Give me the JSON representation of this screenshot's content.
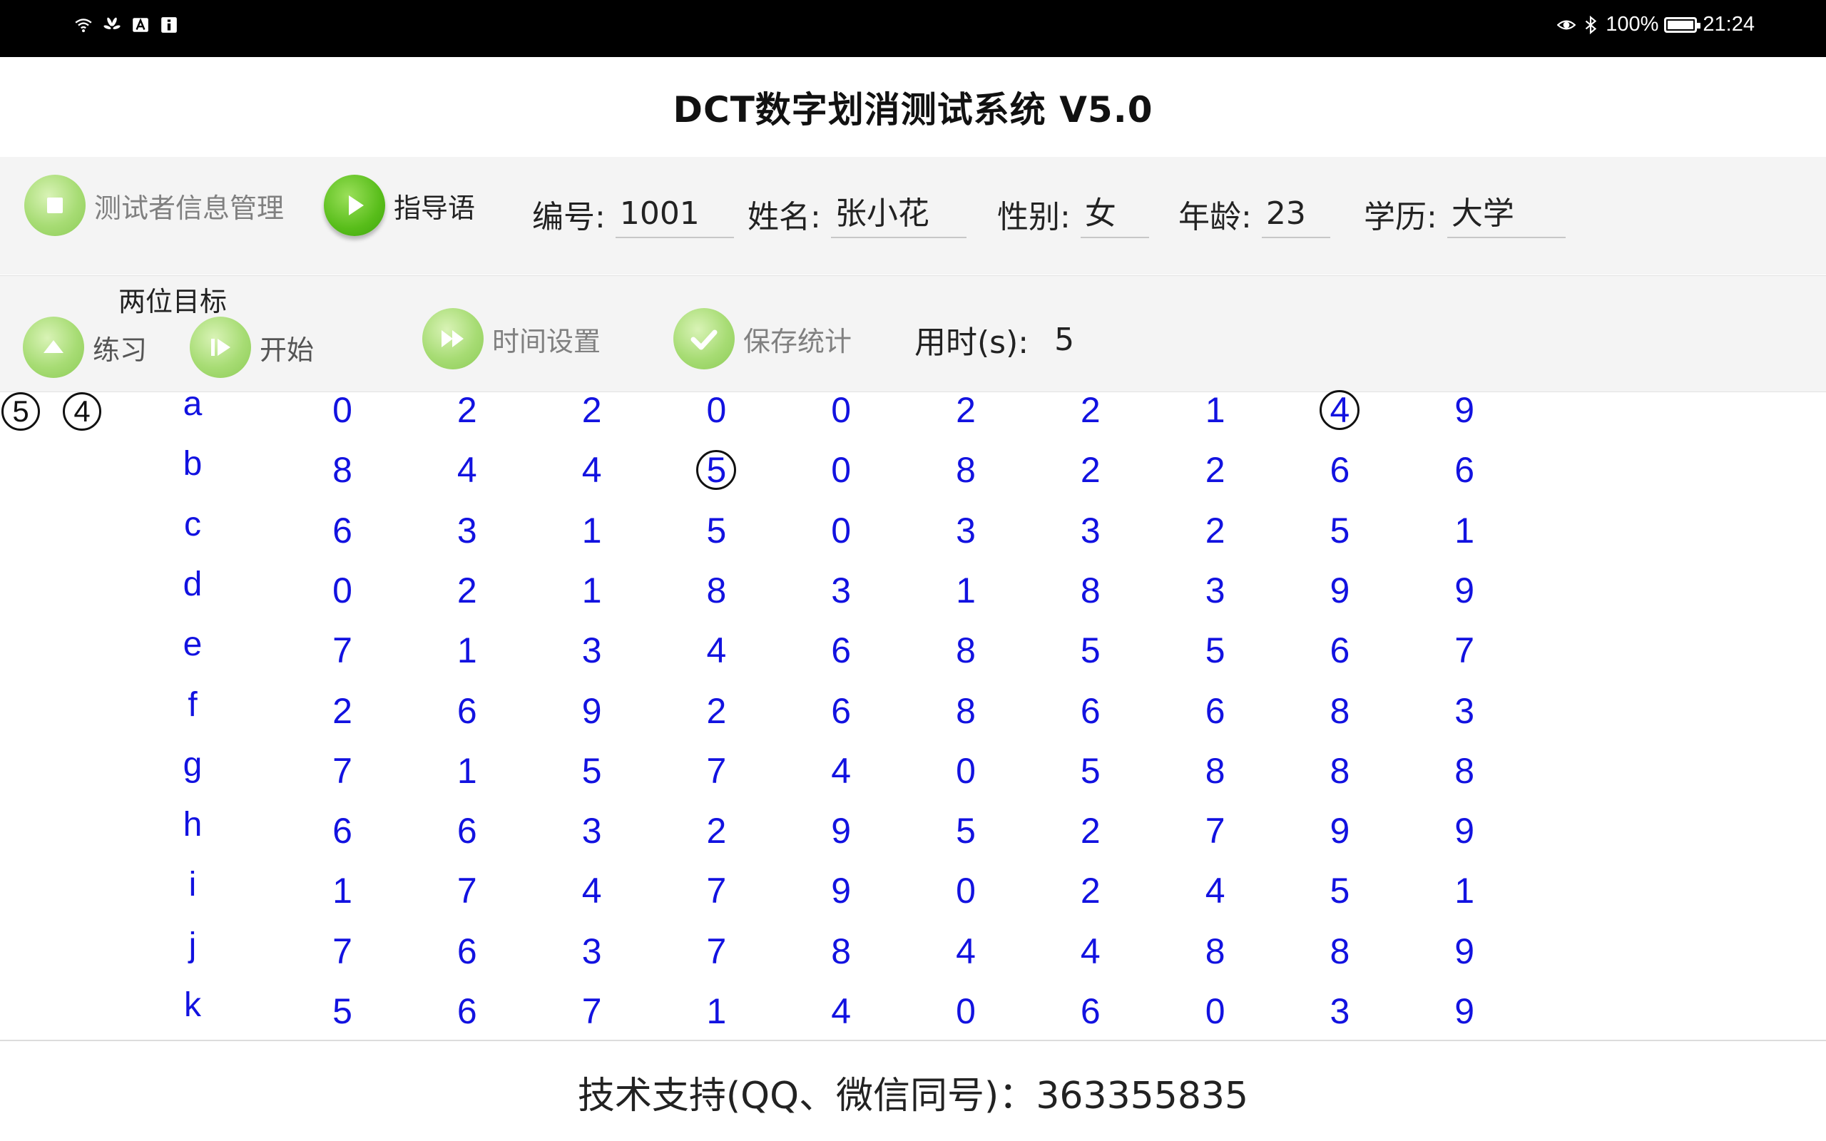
{
  "status_bar": {
    "icons_left": [
      "wifi-icon",
      "huawei-share-icon",
      "app-a-icon",
      "app-i-icon"
    ],
    "icons_right": [
      "eye-comfort-icon",
      "bluetooth-icon"
    ],
    "battery_percent": "100%",
    "battery_level": 100,
    "time": "21:24"
  },
  "app": {
    "title": "DCT数字划消测试系统  V5.0"
  },
  "toolbar": {
    "info_button": "测试者信息管理",
    "guide_button": "指导语",
    "id_label": "编号:",
    "id_value": "1001",
    "name_label": "姓名:",
    "name_value": "张小花",
    "gender_label": "性别:",
    "gender_value": "女",
    "age_label": "年龄:",
    "age_value": "23",
    "edu_label": "学历:",
    "edu_value": "大学"
  },
  "controls": {
    "mode_label": "两位目标",
    "practice_button": "练习",
    "start_button": "开始",
    "time_setting_button": "时间设置",
    "save_stats_button": "保存统计",
    "elapsed_label": "用时(s):",
    "elapsed_value": "5"
  },
  "targets": [
    "5",
    "4"
  ],
  "grid": {
    "rows": [
      {
        "letter": "a",
        "digits": [
          "0",
          "2",
          "2",
          "0",
          "0",
          "2",
          "2",
          "1",
          "4",
          "9"
        ],
        "marked": [
          8
        ]
      },
      {
        "letter": "b",
        "digits": [
          "8",
          "4",
          "4",
          "5",
          "0",
          "8",
          "2",
          "2",
          "6",
          "6"
        ],
        "marked": [
          3
        ]
      },
      {
        "letter": "c",
        "digits": [
          "6",
          "3",
          "1",
          "5",
          "0",
          "3",
          "3",
          "2",
          "5",
          "1"
        ],
        "marked": []
      },
      {
        "letter": "d",
        "digits": [
          "0",
          "2",
          "1",
          "8",
          "3",
          "1",
          "8",
          "3",
          "9",
          "9"
        ],
        "marked": []
      },
      {
        "letter": "e",
        "digits": [
          "7",
          "1",
          "3",
          "4",
          "6",
          "8",
          "5",
          "5",
          "6",
          "7"
        ],
        "marked": []
      },
      {
        "letter": "f",
        "digits": [
          "2",
          "6",
          "9",
          "2",
          "6",
          "8",
          "6",
          "6",
          "8",
          "3"
        ],
        "marked": []
      },
      {
        "letter": "g",
        "digits": [
          "7",
          "1",
          "5",
          "7",
          "4",
          "0",
          "5",
          "8",
          "8",
          "8"
        ],
        "marked": []
      },
      {
        "letter": "h",
        "digits": [
          "6",
          "6",
          "3",
          "2",
          "9",
          "5",
          "2",
          "7",
          "9",
          "9"
        ],
        "marked": []
      },
      {
        "letter": "i",
        "digits": [
          "1",
          "7",
          "4",
          "7",
          "9",
          "0",
          "2",
          "4",
          "5",
          "1"
        ],
        "marked": []
      },
      {
        "letter": "j",
        "digits": [
          "7",
          "6",
          "3",
          "7",
          "8",
          "4",
          "4",
          "8",
          "8",
          "9"
        ],
        "marked": []
      },
      {
        "letter": "k",
        "digits": [
          "5",
          "6",
          "7",
          "1",
          "4",
          "0",
          "6",
          "0",
          "3",
          "9"
        ],
        "marked": []
      }
    ]
  },
  "footer": {
    "support": "技术支持(QQ、微信同号)：363355835"
  },
  "colors": {
    "digit": "#1212e0",
    "button_green": "#58bd1a",
    "button_pale": "#a7dc74",
    "toolbar_bg": "#f4f4f4"
  }
}
